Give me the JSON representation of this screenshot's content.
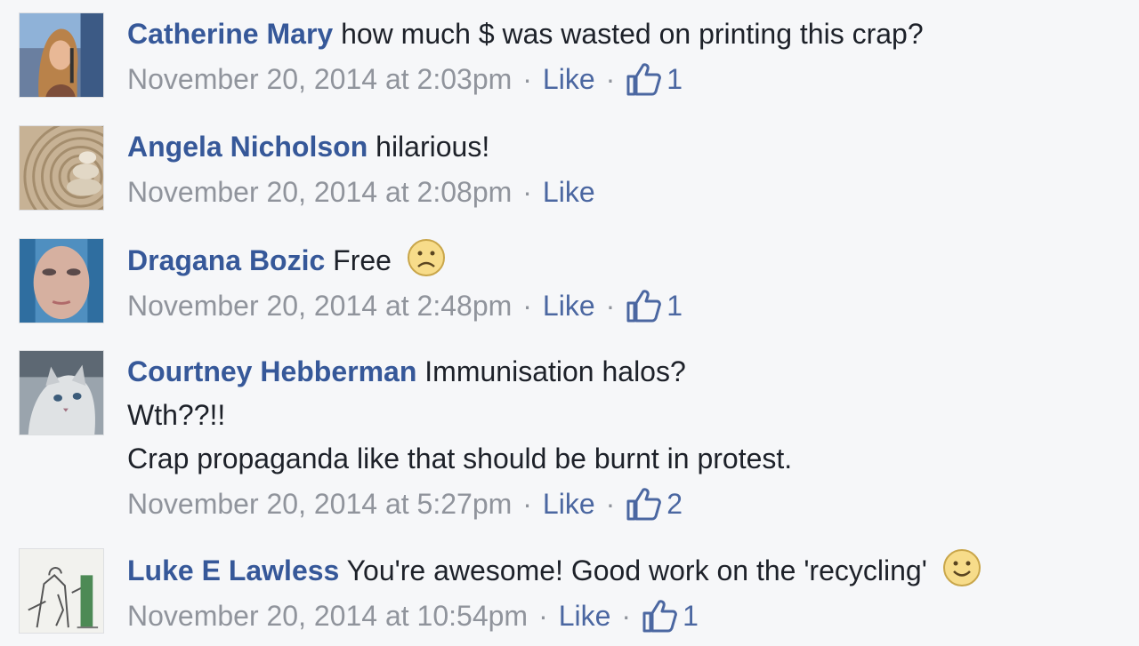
{
  "comments": [
    {
      "author": "Catherine Mary",
      "lines": [
        "how much $ was wasted on printing this crap?"
      ],
      "timestamp": "November 20, 2014 at 2:03pm",
      "like_label": "Like",
      "like_count": "1",
      "avatar_icon": "woman-singing-avatar"
    },
    {
      "author": "Angela Nicholson",
      "lines": [
        "hilarious!"
      ],
      "timestamp": "November 20, 2014 at 2:08pm",
      "like_label": "Like",
      "avatar_icon": "zen-stones-avatar"
    },
    {
      "author": "Dragana Bozic",
      "lines": [
        "Free"
      ],
      "timestamp": "November 20, 2014 at 2:48pm",
      "like_label": "Like",
      "like_count": "1",
      "emoji": "frown-emoji",
      "avatar_icon": "face-avatar"
    },
    {
      "author": "Courtney Hebberman",
      "lines": [
        "Immunisation halos?",
        "Wth??!!",
        "Crap propaganda like that should be burnt in protest."
      ],
      "timestamp": "November 20, 2014 at 5:27pm",
      "like_label": "Like",
      "like_count": "2",
      "avatar_icon": "cat-avatar"
    },
    {
      "author": "Luke E Lawless",
      "lines": [
        "You're awesome! Good work on the 'recycling'"
      ],
      "timestamp": "November 20, 2014 at 10:54pm",
      "like_label": "Like",
      "like_count": "1",
      "emoji": "smile-emoji",
      "avatar_icon": "sketch-avatar"
    }
  ],
  "separator": "·",
  "colors": {
    "author": "#365899",
    "meta": "#90949c",
    "background": "#f6f7f9"
  }
}
